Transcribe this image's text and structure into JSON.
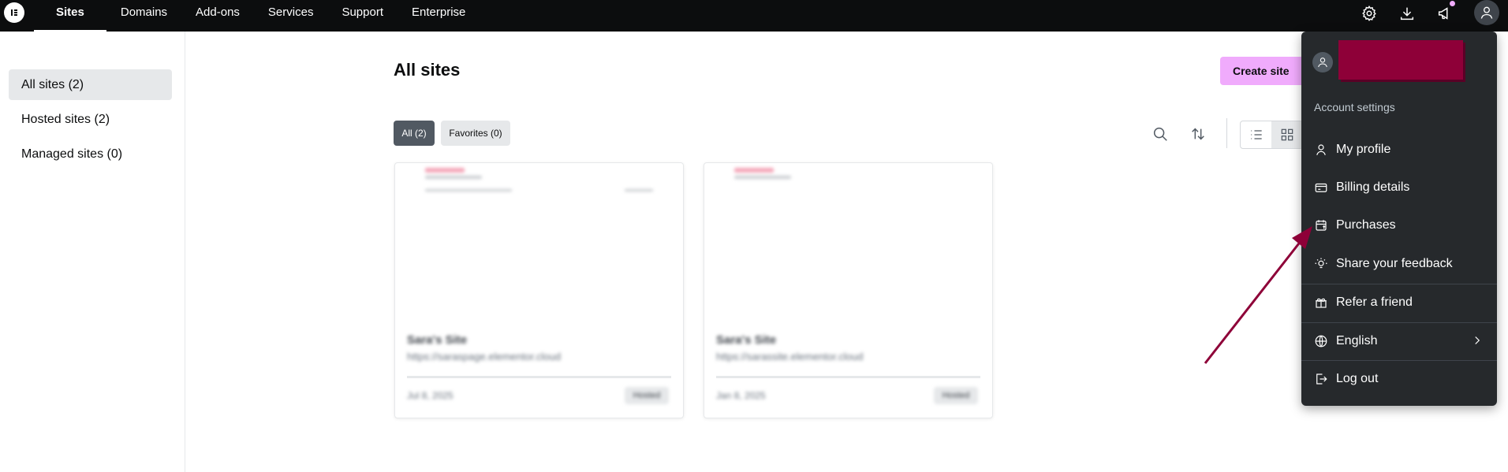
{
  "topnav": {
    "items": [
      {
        "label": "Sites",
        "active": true
      },
      {
        "label": "Domains"
      },
      {
        "label": "Add-ons"
      },
      {
        "label": "Services"
      },
      {
        "label": "Support"
      },
      {
        "label": "Enterprise"
      }
    ],
    "icons": [
      "settings-icon",
      "download-icon",
      "megaphone-icon",
      "user-avatar-icon"
    ],
    "notification_dot_color": "#f0abfc"
  },
  "sidebar": {
    "items": [
      {
        "label": "All sites (2)",
        "active": true
      },
      {
        "label": "Hosted sites (2)"
      },
      {
        "label": "Managed sites (0)"
      }
    ]
  },
  "main": {
    "title": "All sites",
    "create_label": "Create site",
    "filters": {
      "all": "All (2)",
      "favorites": "Favorites (0)"
    },
    "view": "grid"
  },
  "cards": [
    {
      "name": "Sara's Site",
      "url": "https://saraspage.elementor.cloud",
      "date": "Jul 8, 2025",
      "badge": "Hosted"
    },
    {
      "name": "Sara's Site",
      "url": "https://sarassite.elementor.cloud",
      "date": "Jan 8, 2025",
      "badge": "Hosted"
    }
  ],
  "account_menu": {
    "section_label": "Account settings",
    "items": [
      {
        "label": "My profile",
        "icon": "user-icon"
      },
      {
        "label": "Billing details",
        "icon": "credit-card-icon"
      },
      {
        "label": "Purchases",
        "icon": "calendar-dollar-icon"
      },
      {
        "label": "Share your feedback",
        "icon": "bulb-icon"
      },
      {
        "label": "Refer a friend",
        "icon": "gift-icon"
      },
      {
        "label": "English",
        "icon": "globe-icon"
      },
      {
        "label": "Log out",
        "icon": "logout-icon"
      }
    ]
  },
  "colors": {
    "accent": "#f0abfc",
    "annotation_arrow": "#8e0038",
    "menu_bg": "#26292c"
  }
}
